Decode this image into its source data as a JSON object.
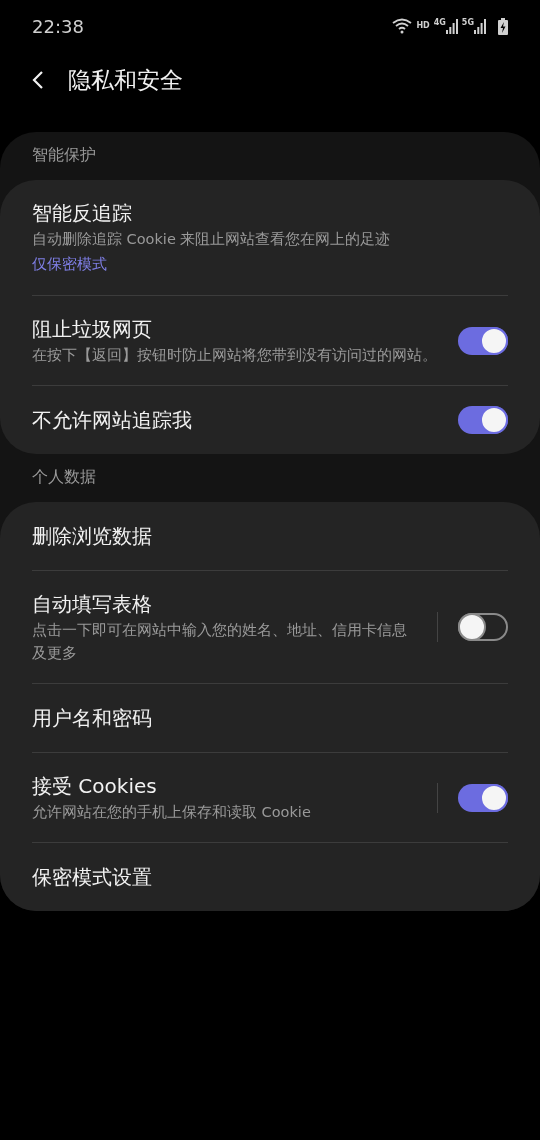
{
  "status_bar": {
    "time": "22:38",
    "network_labels": [
      "HD",
      "4G",
      "5G"
    ]
  },
  "header": {
    "title": "隐私和安全"
  },
  "sections": [
    {
      "title": "智能保护",
      "items": [
        {
          "kind": "link",
          "title": "智能反追踪",
          "description": "自动删除追踪 Cookie 来阻止网站查看您在网上的足迹",
          "link": "仅保密模式"
        },
        {
          "kind": "toggle",
          "title": "阻止垃圾网页",
          "description": "在按下【返回】按钮时防止网站将您带到没有访问过的网站。",
          "on": true
        },
        {
          "kind": "toggle",
          "title": "不允许网站追踪我",
          "on": true
        }
      ]
    },
    {
      "title": "个人数据",
      "items": [
        {
          "kind": "plain",
          "title": "删除浏览数据"
        },
        {
          "kind": "split-toggle",
          "title": "自动填写表格",
          "description": "点击一下即可在网站中输入您的姓名、地址、信用卡信息及更多",
          "on": false
        },
        {
          "kind": "plain",
          "title": "用户名和密码"
        },
        {
          "kind": "split-toggle",
          "title": "接受 Cookies",
          "description": "允许网站在您的手机上保存和读取 Cookie",
          "on": true
        },
        {
          "kind": "plain",
          "title": "保密模式设置"
        }
      ]
    }
  ]
}
